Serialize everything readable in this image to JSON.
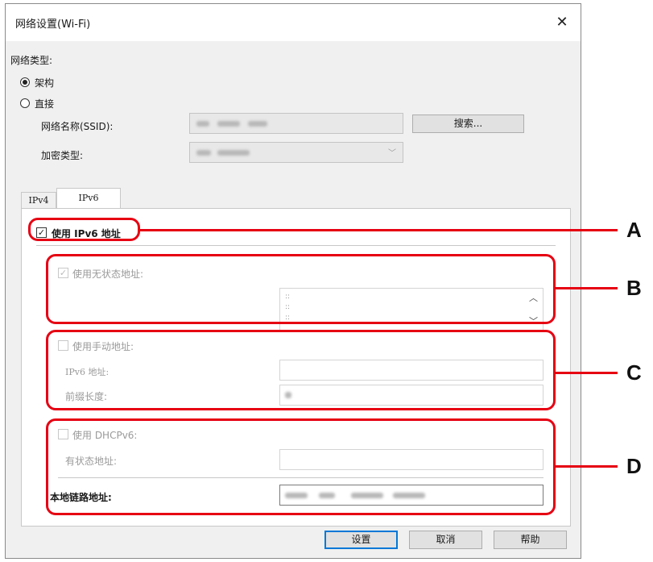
{
  "dialog": {
    "title": "网络设置(Wi-Fi)",
    "close_glyph": "✕"
  },
  "network_type": {
    "label": "网络类型:",
    "options": [
      {
        "label": "架构",
        "checked": true
      },
      {
        "label": "直接",
        "checked": false
      }
    ],
    "ssid_label": "网络名称(SSID):",
    "search_button": "搜索...",
    "encryption_label": "加密类型:"
  },
  "tabs": [
    {
      "label": "IPv4",
      "active": false
    },
    {
      "label": "IPv6",
      "active": true
    }
  ],
  "ipv6": {
    "use_ipv6_label": "使用 IPv6 地址",
    "use_ipv6_checked": true,
    "stateless": {
      "label": "使用无状态地址:",
      "checked": true,
      "list_lines": [
        ":: ",
        ":: ",
        ":: "
      ]
    },
    "manual": {
      "label": "使用手动地址:",
      "checked": false,
      "address_label": "IPv6 地址:",
      "prefix_label": "前缀长度:"
    },
    "dhcp": {
      "label": "使用 DHCPv6:",
      "checked": false,
      "stateful_label": "有状态地址:"
    },
    "link_local_label": "本地链路地址:"
  },
  "footer": {
    "ok_button": "设置",
    "cancel_button": "取消",
    "help_button": "帮助"
  },
  "callouts": [
    "A",
    "B",
    "C",
    "D"
  ],
  "colors": {
    "callout_red": "#e60012",
    "default_button_border": "#0078d7"
  }
}
